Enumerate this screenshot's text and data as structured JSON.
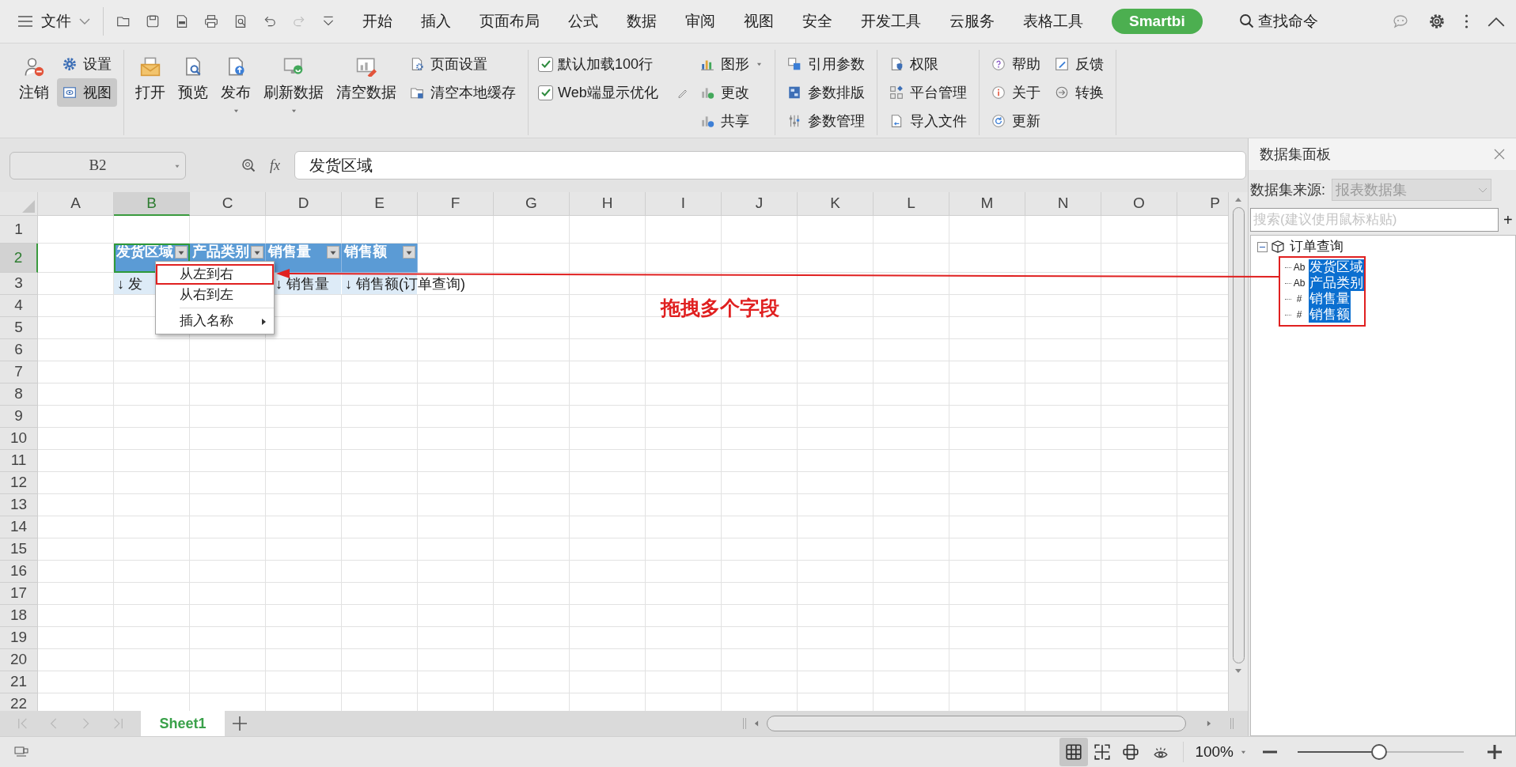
{
  "menu_bar": {
    "file_label": "文件",
    "search_label": "查找命令",
    "tabs": [
      {
        "label": "开始",
        "selected": false
      },
      {
        "label": "插入",
        "selected": false
      },
      {
        "label": "页面布局",
        "selected": false
      },
      {
        "label": "公式",
        "selected": false
      },
      {
        "label": "数据",
        "selected": false
      },
      {
        "label": "审阅",
        "selected": false
      },
      {
        "label": "视图",
        "selected": false
      },
      {
        "label": "安全",
        "selected": false
      },
      {
        "label": "开发工具",
        "selected": false
      },
      {
        "label": "云服务",
        "selected": false
      },
      {
        "label": "表格工具",
        "selected": false
      },
      {
        "label": "Smartbi",
        "selected": true
      }
    ]
  },
  "ribbon": {
    "groups": [
      {
        "items": [
          {
            "kind": "large",
            "label": "注销"
          },
          {
            "kind": "stack",
            "items": [
              {
                "label": "设置",
                "on": false
              },
              {
                "label": "视图",
                "on": true
              }
            ]
          }
        ]
      },
      {
        "items": [
          {
            "kind": "large",
            "label": "打开"
          },
          {
            "kind": "large",
            "label": "预览"
          },
          {
            "kind": "large",
            "label": "发布",
            "caret": true
          },
          {
            "kind": "large",
            "label": "刷新数据",
            "caret": true
          },
          {
            "kind": "large",
            "label": "清空数据"
          },
          {
            "kind": "stack",
            "items": [
              {
                "label": "页面设置"
              },
              {
                "label": "清空本地缓存"
              }
            ]
          }
        ]
      },
      {
        "items": [
          {
            "kind": "checks",
            "items": [
              {
                "label": "默认加载100行",
                "checked": true
              },
              {
                "label": "Web端显示优化",
                "checked": true
              }
            ]
          },
          {
            "kind": "stack",
            "items": [
              {
                "label": "图形",
                "caret": true
              },
              {
                "label": "更改"
              },
              {
                "label": "共享"
              }
            ]
          }
        ]
      },
      {
        "items": [
          {
            "kind": "stack",
            "items": [
              {
                "label": "引用参数"
              },
              {
                "label": "参数排版"
              },
              {
                "label": "参数管理"
              }
            ]
          }
        ]
      },
      {
        "items": [
          {
            "kind": "stack",
            "items": [
              {
                "label": "权限"
              },
              {
                "label": "平台管理"
              },
              {
                "label": "导入文件"
              }
            ]
          }
        ]
      },
      {
        "items": [
          {
            "kind": "stack",
            "items": [
              {
                "label": "帮助"
              },
              {
                "label": "关于"
              },
              {
                "label": "更新"
              }
            ]
          },
          {
            "kind": "stack",
            "items": [
              {
                "label": "反馈"
              },
              {
                "label": "转换"
              }
            ]
          }
        ]
      }
    ]
  },
  "sheet": {
    "name_box": "B2",
    "function_label": "fx",
    "formula": "发货区域",
    "columns": [
      {
        "label": "A",
        "selected": false
      },
      {
        "label": "B",
        "selected": true
      },
      {
        "label": "C",
        "selected": false
      },
      {
        "label": "D",
        "selected": false
      },
      {
        "label": "E",
        "selected": false
      },
      {
        "label": "F",
        "selected": false
      },
      {
        "label": "G",
        "selected": false
      },
      {
        "label": "H",
        "selected": false
      },
      {
        "label": "I",
        "selected": false
      },
      {
        "label": "J",
        "selected": false
      },
      {
        "label": "K",
        "selected": false
      },
      {
        "label": "L",
        "selected": false
      },
      {
        "label": "M",
        "selected": false
      },
      {
        "label": "N",
        "selected": false
      },
      {
        "label": "O",
        "selected": false
      },
      {
        "label": "P",
        "selected": false
      }
    ],
    "rows": [
      {
        "label": "1",
        "selected": false
      },
      {
        "label": "2",
        "selected": true,
        "cells": [
          {
            "kind": "empty"
          },
          {
            "kind": "header",
            "text": "发货区域",
            "filter": true,
            "selected": true
          },
          {
            "kind": "header",
            "text": "产品类别",
            "filter": true,
            "selected": false
          },
          {
            "kind": "header",
            "text": "销售量",
            "filter": true,
            "selected": false
          },
          {
            "kind": "header",
            "text": "销售额",
            "filter": true,
            "selected": false
          }
        ]
      },
      {
        "label": "3",
        "selected": false,
        "cells": [
          {
            "kind": "empty"
          },
          {
            "kind": "field",
            "text": "↓ 发",
            "selected": false
          },
          {
            "kind": "empty"
          },
          {
            "kind": "field",
            "text": "↓ 销售量",
            "selected": false
          },
          {
            "kind": "field",
            "text": "↓ 销售额(订单查询)",
            "selected": false
          }
        ]
      },
      {
        "label": "4",
        "selected": false
      },
      {
        "label": "5",
        "selected": false
      },
      {
        "label": "6",
        "selected": false
      },
      {
        "label": "7",
        "selected": false
      },
      {
        "label": "8",
        "selected": false
      },
      {
        "label": "9",
        "selected": false
      },
      {
        "label": "10",
        "selected": false
      },
      {
        "label": "11",
        "selected": false
      },
      {
        "label": "12",
        "selected": false
      },
      {
        "label": "13",
        "selected": false
      },
      {
        "label": "14",
        "selected": false
      },
      {
        "label": "15",
        "selected": false
      },
      {
        "label": "16",
        "selected": false
      },
      {
        "label": "17",
        "selected": false
      },
      {
        "label": "18",
        "selected": false
      },
      {
        "label": "19",
        "selected": false
      },
      {
        "label": "20",
        "selected": false
      },
      {
        "label": "21",
        "selected": false
      },
      {
        "label": "22",
        "selected": false
      }
    ],
    "context_menu": [
      {
        "kind": "item",
        "label": "从左到右",
        "selected": true
      },
      {
        "kind": "item",
        "label": "从右到左",
        "selected": false
      },
      {
        "kind": "separator"
      },
      {
        "kind": "submenu",
        "label": "插入名称",
        "selected": false
      }
    ],
    "tabs": [
      {
        "label": "Sheet1",
        "selected": true
      }
    ]
  },
  "annotation": {
    "text": "拖拽多个字段"
  },
  "dataset_panel": {
    "title": "数据集面板",
    "source_label": "数据集来源:",
    "source_value": "报表数据集",
    "source_disabled": true,
    "search_placeholder": "搜索(建议使用鼠标粘贴)",
    "add_label": "+",
    "tree": [
      {
        "label": "订单查询",
        "expanded": true,
        "children": [
          {
            "type": "Ab",
            "label": "发货区域",
            "selected": true
          },
          {
            "type": "Ab",
            "label": "产品类别",
            "selected": true
          },
          {
            "type": "#",
            "label": "销售量",
            "selected": true
          },
          {
            "type": "#",
            "label": "销售额",
            "selected": true
          }
        ]
      }
    ]
  },
  "status_bar": {
    "views": [
      {
        "selected": true
      },
      {
        "selected": false
      },
      {
        "selected": false
      }
    ],
    "zoom_text": "100%",
    "zoom": {
      "level": 0.49
    }
  }
}
